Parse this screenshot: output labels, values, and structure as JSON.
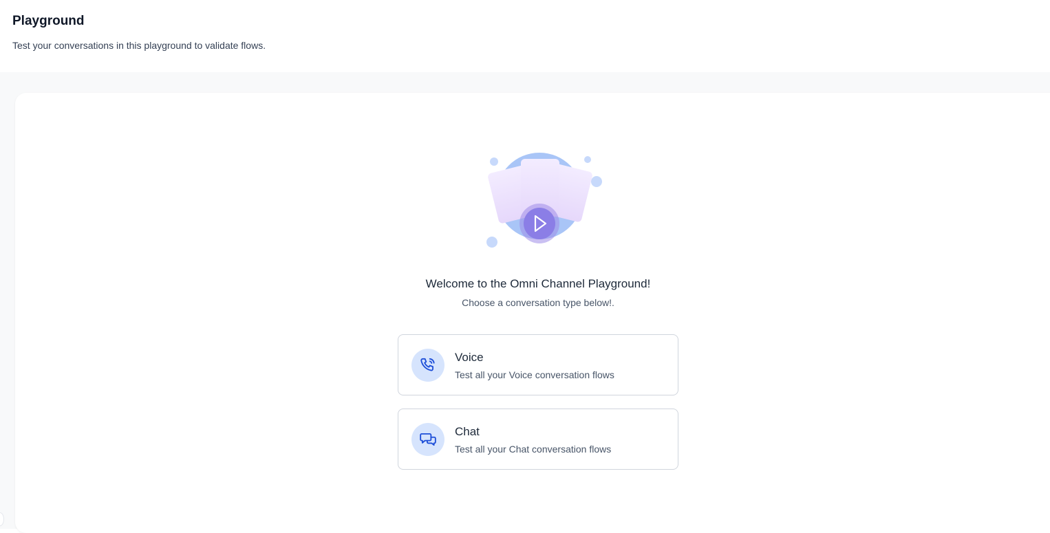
{
  "header": {
    "title": "Playground",
    "subtitle": "Test your conversations in this playground to validate flows."
  },
  "welcome": {
    "title": "Welcome to the Omni Channel Playground!",
    "subtitle": "Choose a conversation type below!."
  },
  "options": [
    {
      "title": "Voice",
      "description": "Test all your Voice conversation flows",
      "icon": "phone-icon"
    },
    {
      "title": "Chat",
      "description": "Test all your Chat conversation flows",
      "icon": "chat-bubbles-icon"
    }
  ],
  "colors": {
    "accent": "#1d4ed8",
    "icon_bg": "#d6e4fd",
    "page_bg": "#f8f9fa",
    "play_button": "#8b7ee6"
  }
}
